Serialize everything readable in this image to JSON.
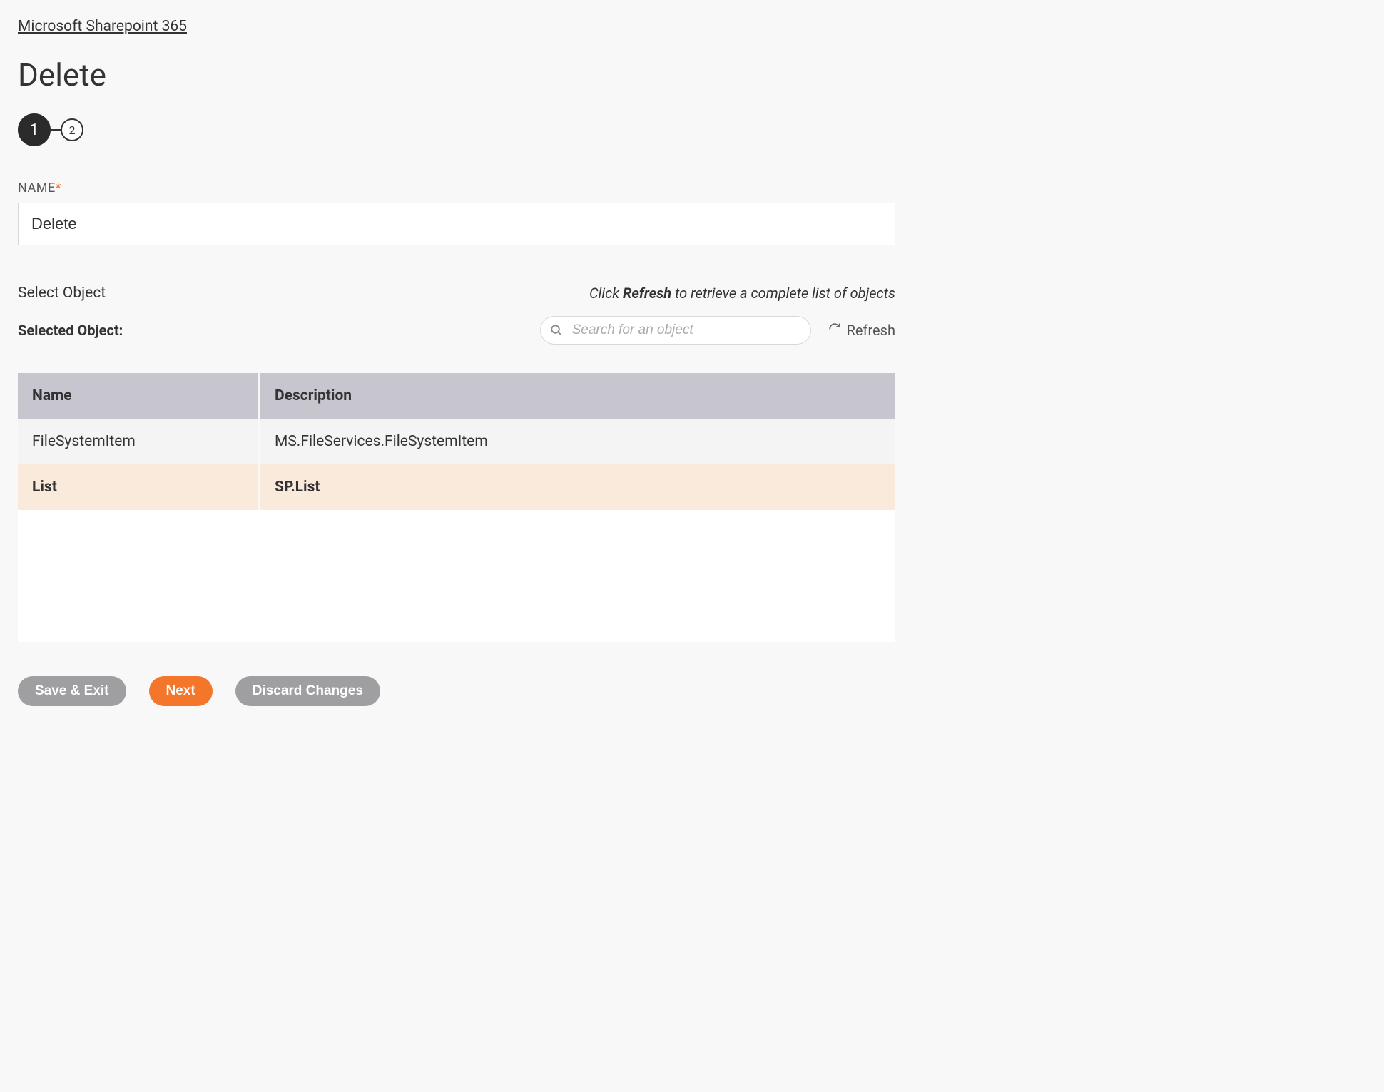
{
  "breadcrumb": "Microsoft Sharepoint 365",
  "title": "Delete",
  "steps": {
    "step1": "1",
    "step2": "2"
  },
  "name_field": {
    "label": "NAME",
    "value": "Delete"
  },
  "select_object": {
    "label": "Select Object",
    "hint_pre": "Click ",
    "hint_strong": "Refresh",
    "hint_post": " to retrieve a complete list of objects",
    "selected_label": "Selected Object:",
    "search_placeholder": "Search for an object",
    "refresh_label": "Refresh"
  },
  "table": {
    "col_name": "Name",
    "col_desc": "Description",
    "rows": [
      {
        "name": "FileSystemItem",
        "description": "MS.FileServices.FileSystemItem",
        "selected": false
      },
      {
        "name": "List",
        "description": "SP.List",
        "selected": true
      }
    ]
  },
  "buttons": {
    "save_exit": "Save & Exit",
    "next": "Next",
    "discard": "Discard Changes"
  }
}
